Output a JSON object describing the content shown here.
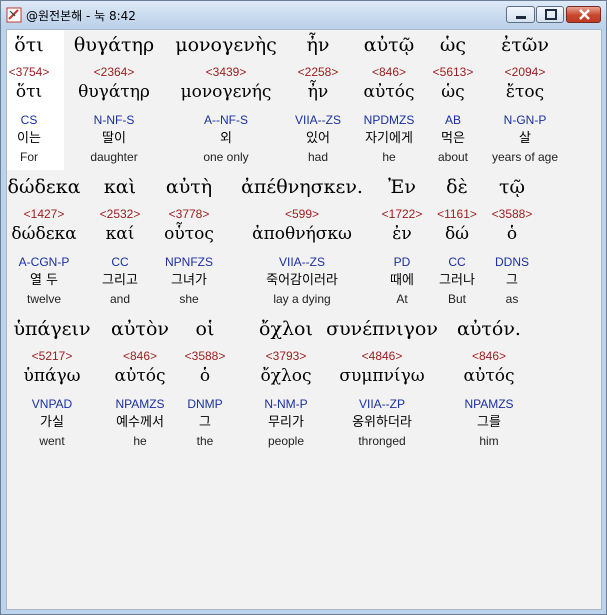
{
  "window": {
    "title": "@원전본해 - 눅 8:42",
    "icon": "bible-app-icon",
    "buttons": [
      "minimize-icon",
      "maximize-icon",
      "close-icon"
    ]
  },
  "rows": [
    {
      "words": [
        {
          "greek": "ὅτι",
          "strong": "<3754>",
          "lemma": "ὅτι",
          "parse": "CS",
          "korean": "이는",
          "english": "For"
        },
        {
          "greek": "θυγάτηρ",
          "strong": "<2364>",
          "lemma": "θυγάτηρ",
          "parse": "N-NF-S",
          "korean": "딸이",
          "english": "daughter"
        },
        {
          "greek": "μονογενὴς",
          "strong": "<3439>",
          "lemma": "μονογενής",
          "parse": "A--NF-S",
          "korean": "외",
          "english": "one only"
        },
        {
          "greek": "ἦν",
          "strong": "<2258>",
          "lemma": "ἦν",
          "parse": "VIIA--ZS",
          "korean": "있어",
          "english": "had"
        },
        {
          "greek": "αὐτῷ",
          "strong": "<846>",
          "lemma": "αὐτός",
          "parse": "NPDMZS",
          "korean": "자기에게",
          "english": "he"
        },
        {
          "greek": "ὡς",
          "strong": "<5613>",
          "lemma": "ὡς",
          "parse": "AB",
          "korean": "먹은",
          "english": "about"
        },
        {
          "greek": "ἐτῶν",
          "strong": "<2094>",
          "lemma": "ἔτος",
          "parse": "N-GN-P",
          "korean": "살",
          "english": "years of age"
        }
      ]
    },
    {
      "words": [
        {
          "greek": "δώδεκα",
          "strong": "<1427>",
          "lemma": "δώδεκα",
          "parse": "A-CGN-P",
          "korean": "열 두",
          "english": "twelve"
        },
        {
          "greek": "καὶ",
          "strong": "<2532>",
          "lemma": "καί",
          "parse": "CC",
          "korean": "그리고",
          "english": "and"
        },
        {
          "greek": "αὐτὴ",
          "strong": "<3778>",
          "lemma": "οὗτος",
          "parse": "NPNFZS",
          "korean": "그녀가",
          "english": "she"
        },
        {
          "greek": "ἀπέθνησκεν.",
          "strong": "<599>",
          "lemma": "ἀποθνήσκω",
          "parse": "VIIA--ZS",
          "korean": "죽어감이러라",
          "english": "lay a dying"
        },
        {
          "greek": "Ἐν",
          "strong": "<1722>",
          "lemma": "ἐν",
          "parse": "PD",
          "korean": "때에",
          "english": "At"
        },
        {
          "greek": "δὲ",
          "strong": "<1161>",
          "lemma": "δώ",
          "parse": "CC",
          "korean": "그러나",
          "english": "But"
        },
        {
          "greek": "τῷ",
          "strong": "<3588>",
          "lemma": "ὁ",
          "parse": "DDNS",
          "korean": "그",
          "english": "as"
        }
      ]
    },
    {
      "words": [
        {
          "greek": "ὑπάγειν",
          "strong": "<5217>",
          "lemma": "ὑπάγω",
          "parse": "VNPAD",
          "korean": "가실",
          "english": "went"
        },
        {
          "greek": "αὐτὸν",
          "strong": "<846>",
          "lemma": "αὐτός",
          "parse": "NPAMZS",
          "korean": "예수께서",
          "english": "he"
        },
        {
          "greek": "οἱ",
          "strong": "<3588>",
          "lemma": "ὁ",
          "parse": "DNMP",
          "korean": "그",
          "english": "the"
        },
        {
          "greek": "ὄχλοι",
          "strong": "<3793>",
          "lemma": "ὄχλος",
          "parse": "N-NM-P",
          "korean": "무리가",
          "english": "people"
        },
        {
          "greek": "συνέπνιγον",
          "strong": "<4846>",
          "lemma": "συμπνίγω",
          "parse": "VIIA--ZP",
          "korean": "옹위하더라",
          "english": "thronged"
        },
        {
          "greek": "αὐτόν.",
          "strong": "<846>",
          "lemma": "αὐτός",
          "parse": "NPAMZS",
          "korean": "그를",
          "english": "him"
        }
      ]
    }
  ],
  "colors": {
    "strong": "#9b1c1c",
    "parse": "#1a2fa0",
    "background": "#f2f2f2",
    "selected": "#ffffff"
  }
}
